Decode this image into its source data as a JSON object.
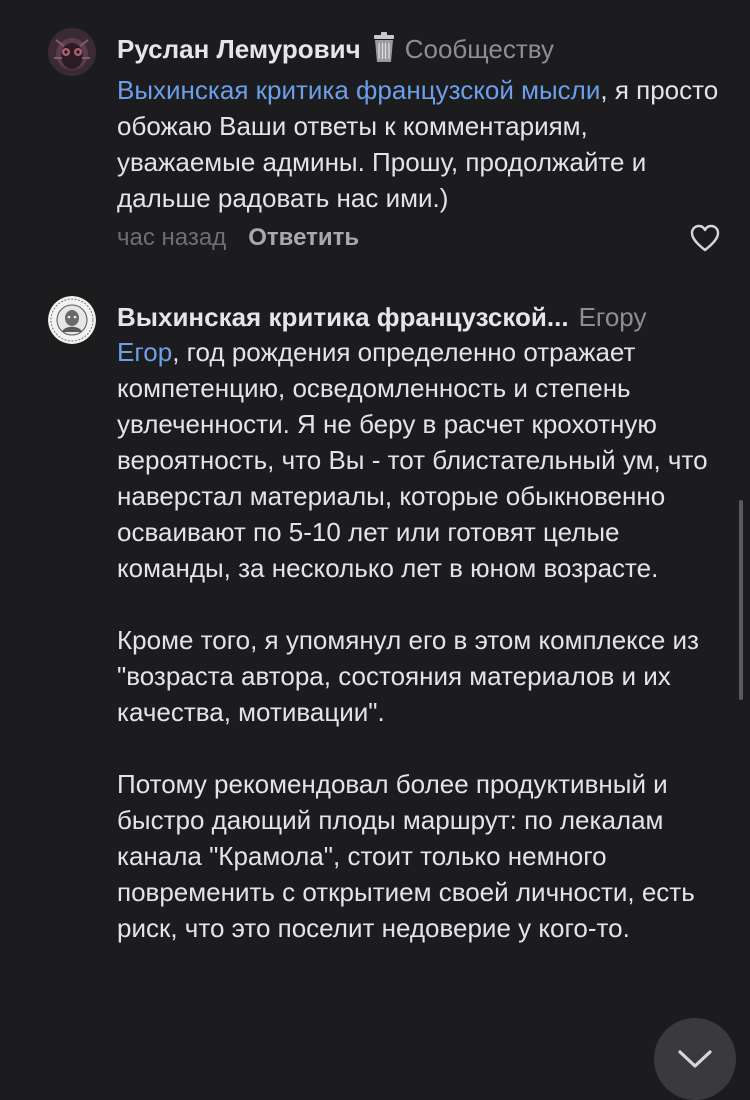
{
  "comments": [
    {
      "author": "Руслан Лемурович",
      "author_icon": "trash-icon",
      "reply_to": "Сообществу",
      "mention": "Выхинская критика французской мысли",
      "text_after_mention": ", я просто обожаю Ваши ответы к комментариям, уважаемые админы. Прошу, продолжайте и дальше радовать нас ими.)",
      "time": "час назад",
      "reply_label": "Ответить",
      "like_icon": "heart-icon"
    },
    {
      "author": "Выхинская критика французской...",
      "reply_to": "Егору",
      "mention": "Егор",
      "paragraphs": [
        ", год рождения определенно отражает компетенцию, осведомленность и степень увлеченности. Я не беру в расчет крохотную вероятность, что Вы - тот блистательный ум, что наверстал материалы, которые обыкновенно осваивают по 5-10 лет или готовят целые команды, за несколько лет в юном возрасте.",
        "Кроме того, я упомянул его в этом комплексе из \"возраста автора, состояния материалов и их качества, мотивации\".",
        "Потому рекомендовал более продуктивный и быстро дающий плоды маршрут: по лекалам канала \"Крамола\", стоит только немного повременить с открытием своей личности, есть риск, что это поселит недоверие у кого-то."
      ]
    }
  ],
  "scroll_button_icon": "chevron-down-icon",
  "colors": {
    "background": "#1c1c1e",
    "text": "#e4e4e6",
    "mention": "#6b9fea",
    "muted": "#8d8d93",
    "fab": "#3a3a3d"
  }
}
